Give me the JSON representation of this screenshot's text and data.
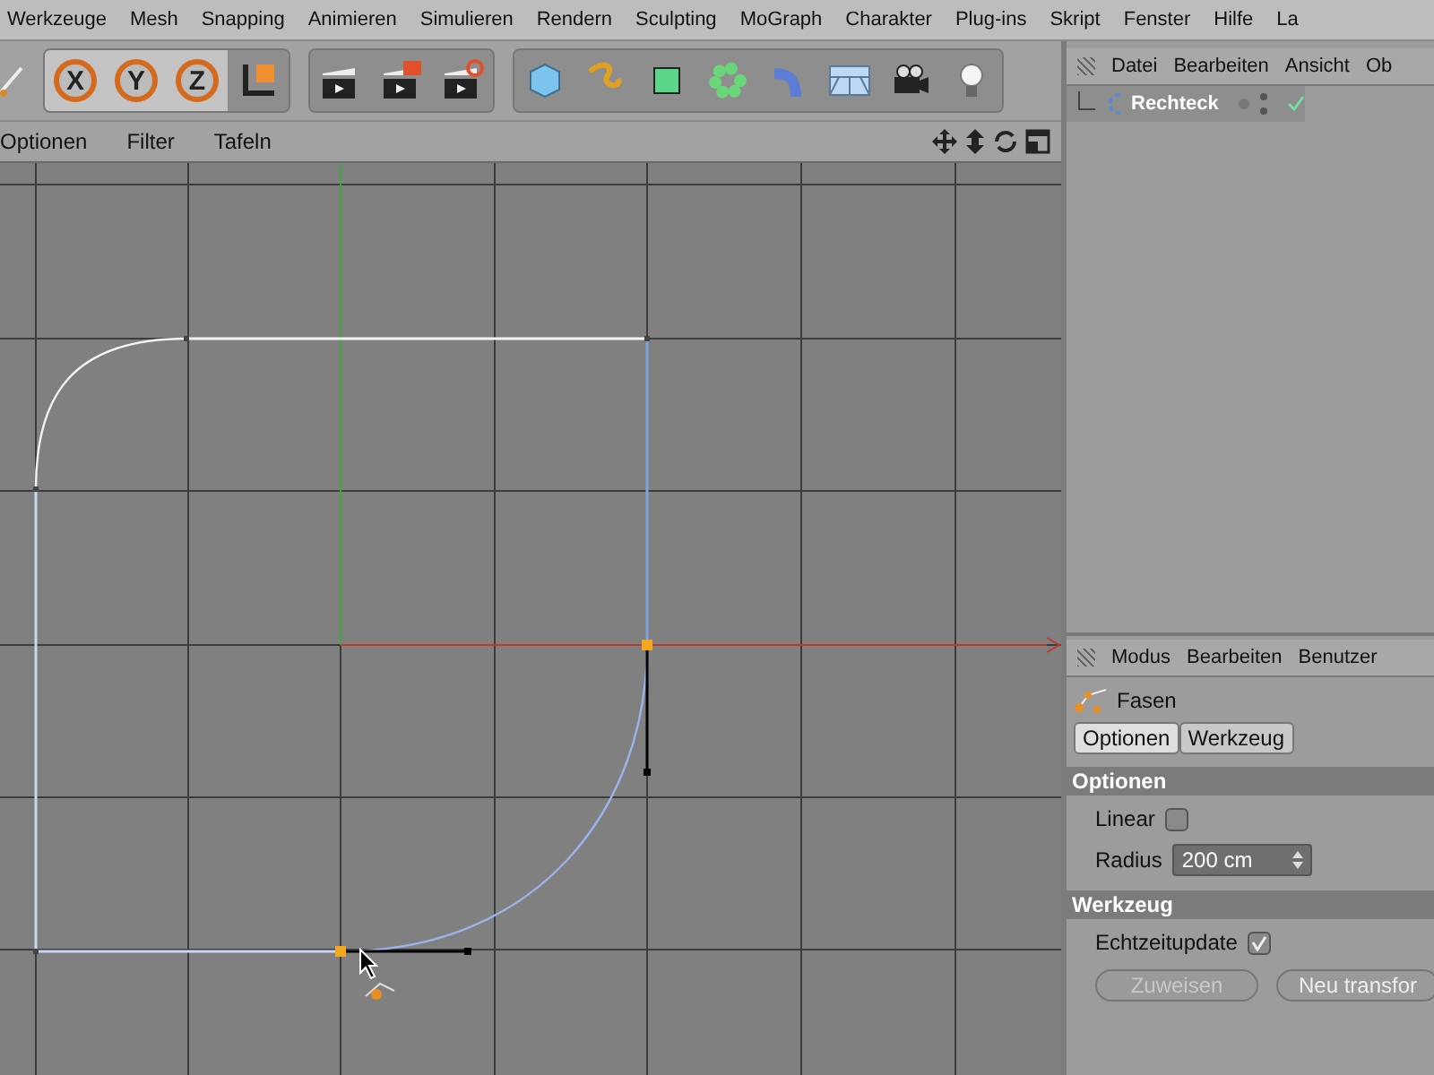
{
  "menu_bar": [
    "Werkzeuge",
    "Mesh",
    "Snapping",
    "Animieren",
    "Simulieren",
    "Rendern",
    "Sculpting",
    "MoGraph",
    "Charakter",
    "Plug-ins",
    "Skript",
    "Fenster",
    "Hilfe",
    "La"
  ],
  "axis_buttons": [
    {
      "label": "X",
      "active": true
    },
    {
      "label": "Y",
      "active": true
    },
    {
      "label": "Z",
      "active": true
    }
  ],
  "viewport_menu": [
    "Optionen",
    "Filter",
    "Tafeln"
  ],
  "object_manager": {
    "menu": [
      "Datei",
      "Bearbeiten",
      "Ansicht",
      "Ob"
    ],
    "objects": [
      {
        "name": "Rechteck",
        "enabled": true
      }
    ]
  },
  "attribute_manager": {
    "menu": [
      "Modus",
      "Bearbeiten",
      "Benutzer"
    ],
    "tool": "Fasen",
    "tabs": [
      {
        "label": "Optionen",
        "selected": true
      },
      {
        "label": "Werkzeug",
        "selected": false
      }
    ],
    "sections": [
      {
        "title": "Optionen",
        "fields": [
          {
            "kind": "checkbox",
            "label": "Linear",
            "checked": false
          },
          {
            "kind": "number",
            "label": "Radius",
            "value": "200 cm"
          }
        ]
      },
      {
        "title": "Werkzeug",
        "fields": [
          {
            "kind": "checkbox",
            "label": "Echtzeitupdate",
            "checked": true
          }
        ]
      }
    ],
    "buttons": [
      {
        "label": "Zuweisen",
        "disabled": true
      },
      {
        "label": "Neu transfor",
        "disabled": false
      }
    ]
  }
}
